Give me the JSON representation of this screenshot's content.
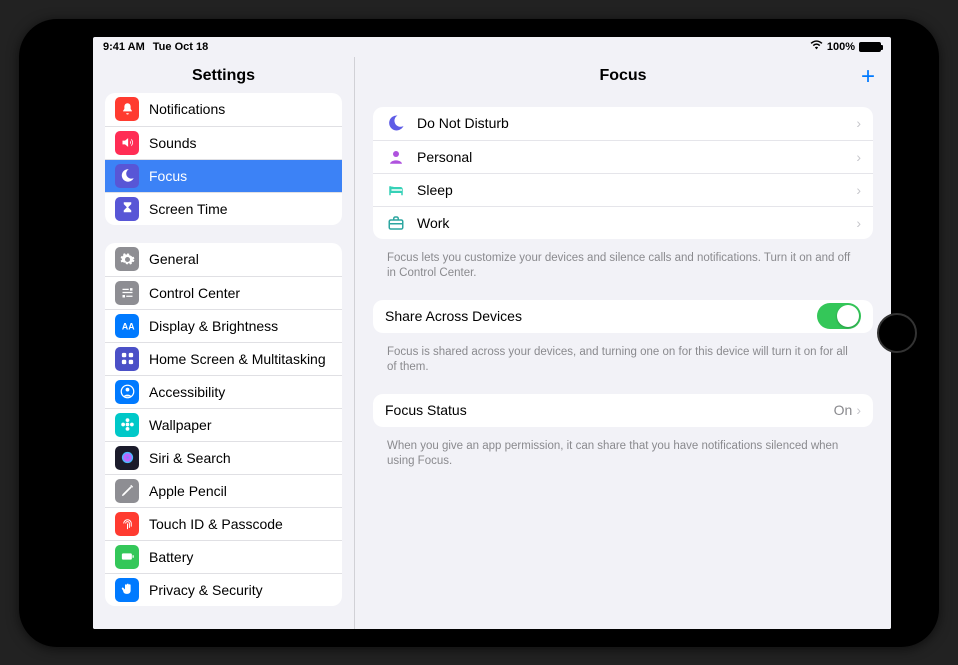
{
  "status": {
    "time": "9:41 AM",
    "date": "Tue Oct 18",
    "battery_pct": "100%"
  },
  "sidebar": {
    "title": "Settings",
    "group1": [
      {
        "label": "Notifications",
        "icon": "bell",
        "color": "#ff3b30"
      },
      {
        "label": "Sounds",
        "icon": "speaker",
        "color": "#ff2d55"
      },
      {
        "label": "Focus",
        "icon": "moon",
        "color": "#5856d6",
        "selected": true
      },
      {
        "label": "Screen Time",
        "icon": "hourglass",
        "color": "#5856d6"
      }
    ],
    "group2": [
      {
        "label": "General",
        "icon": "gear",
        "color": "#8e8e93"
      },
      {
        "label": "Control Center",
        "icon": "sliders",
        "color": "#8e8e93"
      },
      {
        "label": "Display & Brightness",
        "icon": "aa",
        "color": "#007aff"
      },
      {
        "label": "Home Screen & Multitasking",
        "icon": "grid",
        "color": "#4b50c7"
      },
      {
        "label": "Accessibility",
        "icon": "person",
        "color": "#007aff"
      },
      {
        "label": "Wallpaper",
        "icon": "flower",
        "color": "#00c8c8"
      },
      {
        "label": "Siri & Search",
        "icon": "siri",
        "color": "#1b1b2b"
      },
      {
        "label": "Apple Pencil",
        "icon": "pencil",
        "color": "#8e8e93"
      },
      {
        "label": "Touch ID & Passcode",
        "icon": "fingerprint",
        "color": "#ff3b30"
      },
      {
        "label": "Battery",
        "icon": "battery",
        "color": "#34c759"
      },
      {
        "label": "Privacy & Security",
        "icon": "hand",
        "color": "#007aff"
      }
    ]
  },
  "detail": {
    "title": "Focus",
    "modes": [
      {
        "label": "Do Not Disturb",
        "icon": "moon",
        "color": "#5e5ce6"
      },
      {
        "label": "Personal",
        "icon": "person-solid",
        "color": "#af52de"
      },
      {
        "label": "Sleep",
        "icon": "bed",
        "color": "#36d1b7"
      },
      {
        "label": "Work",
        "icon": "briefcase",
        "color": "#2da6a0"
      }
    ],
    "modes_footer": "Focus lets you customize your devices and silence calls and notifications. Turn it on and off in Control Center.",
    "share_label": "Share Across Devices",
    "share_footer": "Focus is shared across your devices, and turning one on for this device will turn it on for all of them.",
    "status_label": "Focus Status",
    "status_value": "On",
    "status_footer": "When you give an app permission, it can share that you have notifications silenced when using Focus."
  }
}
